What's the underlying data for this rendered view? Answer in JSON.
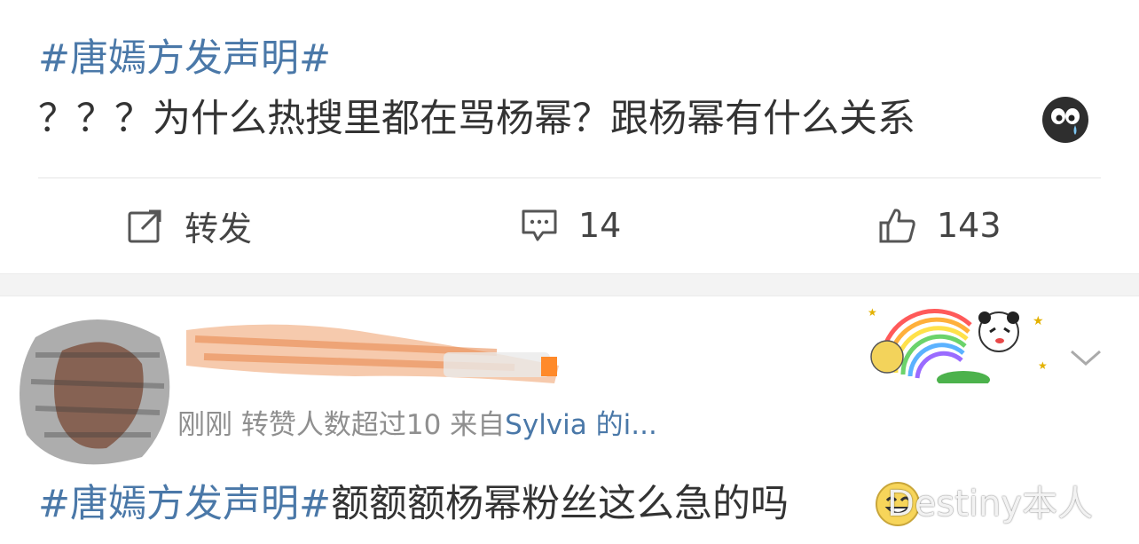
{
  "post1": {
    "hashtag": "#唐嫣方发声明#",
    "text": "？？？为什么热搜里都在骂杨幂？跟杨幂有什么关系",
    "emoji_icon": "crying-sweat-emoji-icon",
    "actions": {
      "repost_label": "转发",
      "comment_count": "14",
      "like_count": "143"
    }
  },
  "post2": {
    "meta_time": "刚刚",
    "meta_note": "转赞人数超过10",
    "meta_from": "来自",
    "meta_source": "Sylvia 的i...",
    "hashtag": "#唐嫣方发声明#",
    "text": "额额额杨幂粉丝这么急的吗",
    "emoji_icon": "grin-emoji-icon",
    "banner_icon": "panda-rainbow-banner-icon",
    "menu_icon": "chevron-down-icon"
  },
  "watermark": "Destiny本人",
  "colors": {
    "link_blue": "#4a78a8",
    "text": "#333333",
    "muted": "#8f8f8f",
    "divider": "#e5e5e5",
    "band": "#f3f3f3"
  }
}
